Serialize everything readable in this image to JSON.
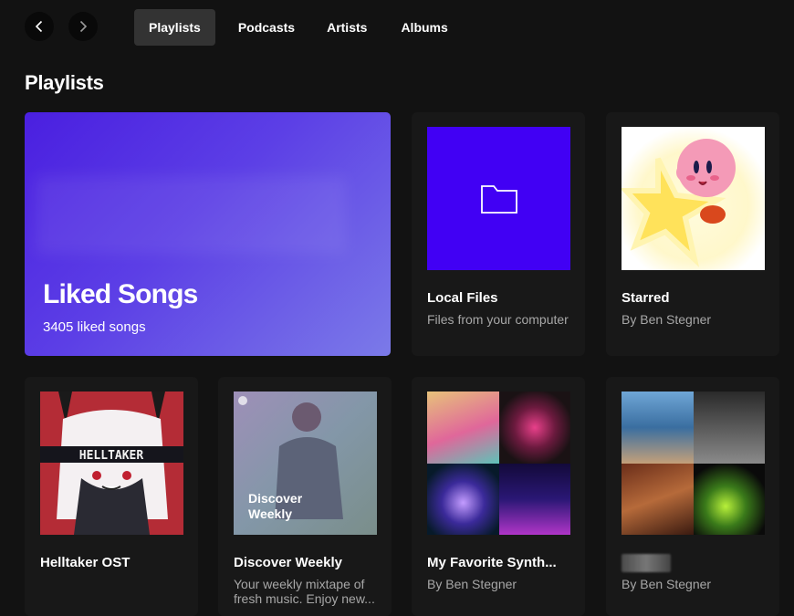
{
  "nav": {
    "back_icon": "chevron-left-icon",
    "forward_icon": "chevron-right-icon"
  },
  "tabs": [
    {
      "label": "Playlists",
      "active": true
    },
    {
      "label": "Podcasts",
      "active": false
    },
    {
      "label": "Artists",
      "active": false
    },
    {
      "label": "Albums",
      "active": false
    }
  ],
  "section_title": "Playlists",
  "liked": {
    "title": "Liked Songs",
    "count_text": "3405 liked songs"
  },
  "cards": [
    {
      "title": "Local Files",
      "subtitle": "Files from your computer",
      "icon": "folder-icon"
    },
    {
      "title": "Starred",
      "subtitle": "By Ben Stegner"
    },
    {
      "title": "Helltaker OST",
      "subtitle": "",
      "art_text": "HELLTAKER"
    },
    {
      "title": "Discover Weekly",
      "subtitle": "Your weekly mixtape of fresh music. Enjoy new...",
      "art_text": "Discover Weekly"
    },
    {
      "title": "My Favorite Synth...",
      "subtitle": "By Ben Stegner"
    },
    {
      "title": "",
      "subtitle": "By Ben Stegner"
    }
  ],
  "colors": {
    "background": "#121212",
    "card": "#181818",
    "liked_gradient_start": "#4a1fe0",
    "local_files_blue": "#4100f4",
    "subtext": "#a7a7a7"
  }
}
